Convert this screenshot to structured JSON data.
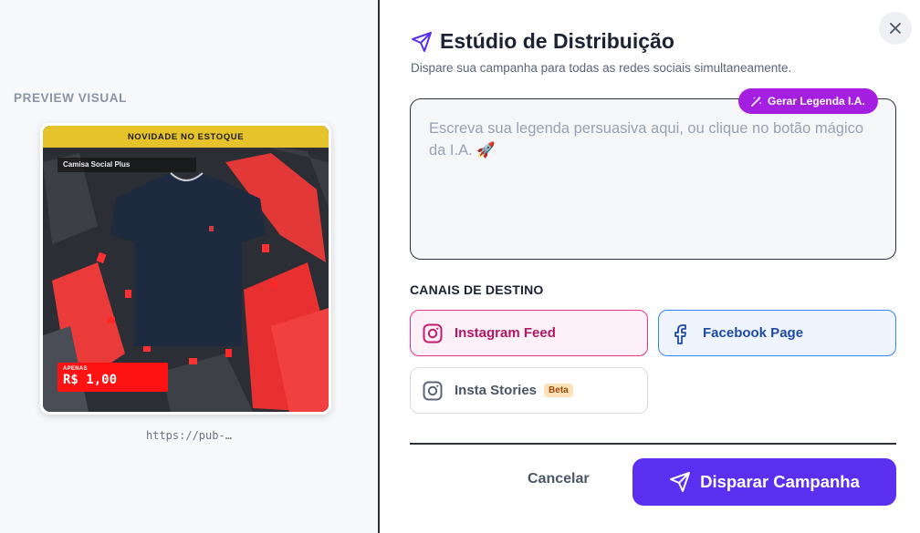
{
  "preview": {
    "label": "PREVIEW VISUAL",
    "banner": "NOVIDADE NO ESTOQUE",
    "product_name": "Camisa Social Plus",
    "price_prefix": "APENAS",
    "price": "R$ 1,00",
    "url": "https://pub-…"
  },
  "header": {
    "title": "Estúdio de Distribuição",
    "subtitle": "Dispare sua campanha para todas as redes sociais simultaneamente.",
    "title_icon": "send-icon",
    "close_icon": "close-icon"
  },
  "caption": {
    "placeholder": "Escreva sua legenda persuasiva aqui, ou clique no botão mágico da I.A. 🚀",
    "value": "",
    "ai_button_label": "Gerar Legenda I.A."
  },
  "channels": {
    "label": "CANAIS DE DESTINO",
    "instagram_feed": "Instagram Feed",
    "facebook_page": "Facebook Page",
    "insta_stories": "Insta Stories",
    "beta_badge": "Beta"
  },
  "actions": {
    "cancel_label": "Cancelar",
    "submit_label": "Disparar Campanha"
  },
  "colors": {
    "accent": "#5b2ff0",
    "ai_button": "#a51fe0",
    "instagram": "#e8348c",
    "facebook": "#3b82f6"
  }
}
